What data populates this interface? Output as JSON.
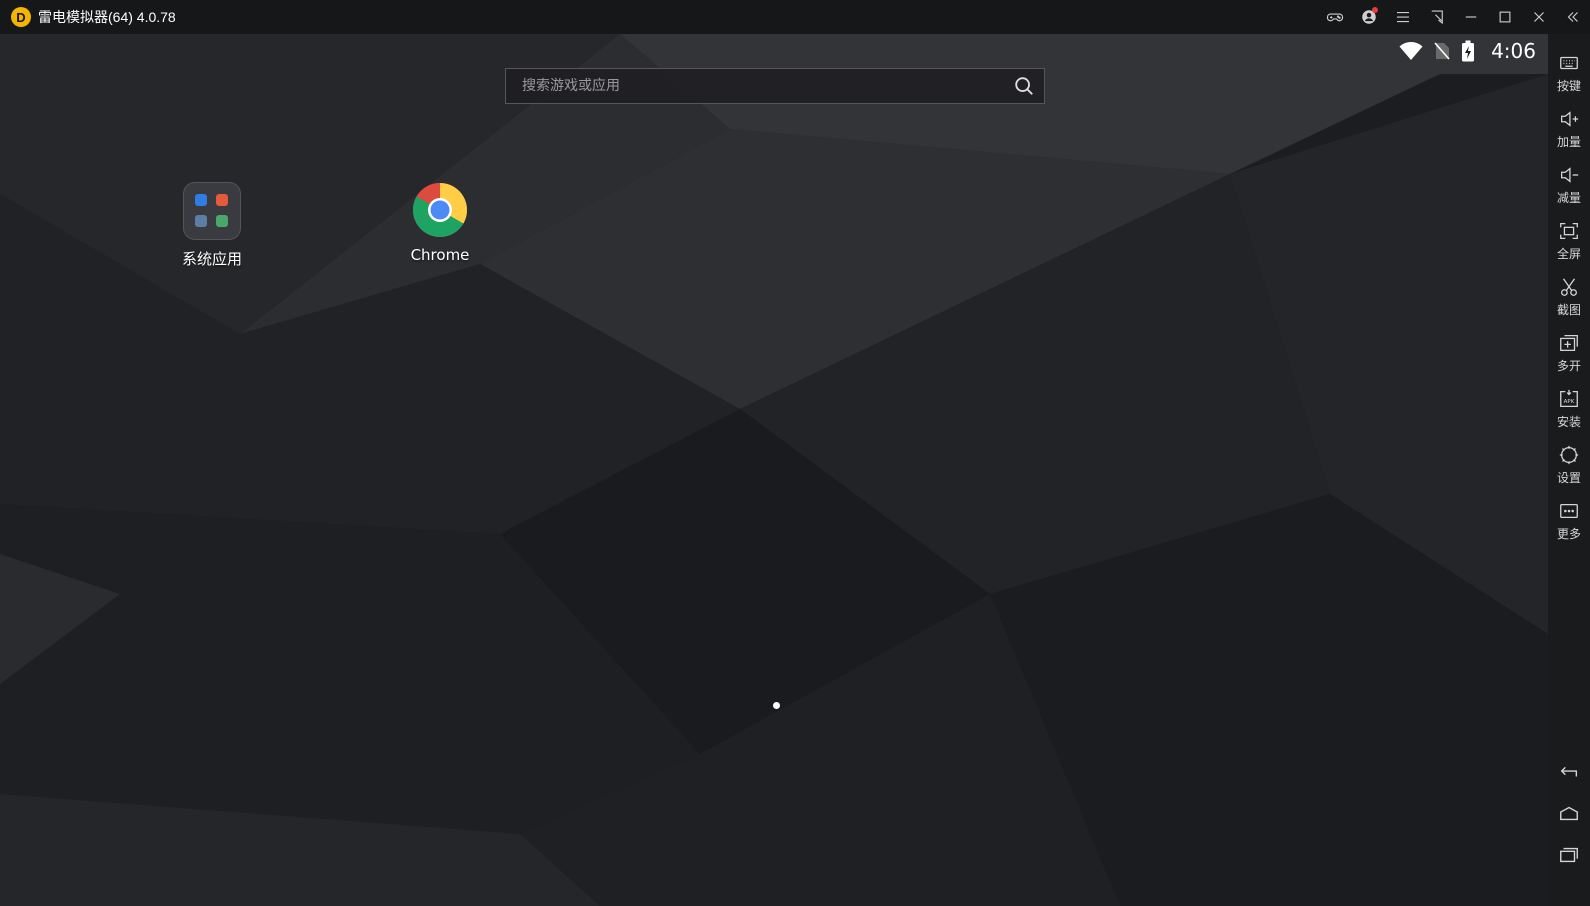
{
  "window": {
    "logo_glyph": "D",
    "title": "雷电模拟器(64) 4.0.78",
    "controls": [
      "gamepad-icon",
      "account-icon",
      "menu-icon",
      "pin-icon",
      "minimize-icon",
      "maximize-icon",
      "close-icon",
      "collapse-icon"
    ],
    "accent_color": "#f5b400",
    "notification_dot_color": "#e83a3a"
  },
  "statusbar": {
    "icons": [
      "wifi-icon",
      "no-sim-icon",
      "battery-charging-icon"
    ],
    "time": "4:06"
  },
  "search": {
    "placeholder": "搜索游戏或应用",
    "value": ""
  },
  "apps": [
    {
      "label": "系统应用",
      "icon": "folder-icon"
    },
    {
      "label": "Chrome",
      "icon": "chrome-icon"
    }
  ],
  "pager": {
    "pages": 1,
    "current": 1
  },
  "sidebar": {
    "items": [
      {
        "label": "按键",
        "icon": "keyboard-icon"
      },
      {
        "label": "加量",
        "icon": "volume-up-icon"
      },
      {
        "label": "减量",
        "icon": "volume-down-icon"
      },
      {
        "label": "全屏",
        "icon": "fullscreen-icon"
      },
      {
        "label": "截图",
        "icon": "scissors-icon"
      },
      {
        "label": "多开",
        "icon": "multi-instance-icon"
      },
      {
        "label": "安装",
        "icon": "apk-install-icon"
      },
      {
        "label": "设置",
        "icon": "settings-gear-icon"
      },
      {
        "label": "更多",
        "icon": "more-icon"
      }
    ],
    "nav": [
      "back-icon",
      "home-icon",
      "recents-icon"
    ]
  }
}
